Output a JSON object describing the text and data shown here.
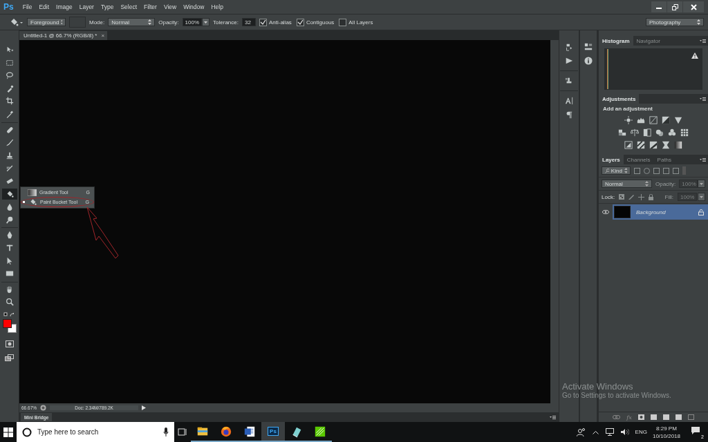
{
  "app": {
    "logo": "Ps"
  },
  "menu": [
    "File",
    "Edit",
    "Image",
    "Layer",
    "Type",
    "Select",
    "Filter",
    "View",
    "Window",
    "Help"
  ],
  "options_bar": {
    "fill_source": "Foreground",
    "mode_label": "Mode:",
    "mode": "Normal",
    "opacity_label": "Opacity:",
    "opacity": "100%",
    "tolerance_label": "Tolerance:",
    "tolerance": "32",
    "checkboxes": [
      {
        "label": "Anti-alias",
        "checked": true
      },
      {
        "label": "Contiguous",
        "checked": true
      },
      {
        "label": "All Layers",
        "checked": false
      }
    ],
    "workspace": "Photography"
  },
  "document_tab": {
    "title": "Untitled-1 @ 66.7% (RGB/8) *",
    "close": "×"
  },
  "tools": [
    {
      "selected": false
    },
    {
      "selected": false
    },
    {
      "selected": false
    },
    {
      "selected": false
    },
    {
      "selected": false
    },
    {
      "selected": false
    },
    {
      "selected": false
    },
    {
      "selected": false
    },
    {
      "selected": false
    },
    {
      "selected": false
    },
    {
      "selected": false
    },
    {
      "selected": true
    },
    {
      "selected": false
    },
    {
      "selected": false
    },
    {
      "selected": false
    },
    {
      "selected": false
    },
    {
      "selected": false
    },
    {
      "selected": false
    },
    {
      "selected": false
    },
    {
      "selected": false
    }
  ],
  "flyout": [
    {
      "label": "Gradient Tool",
      "shortcut": "G",
      "selected": false
    },
    {
      "label": "Paint Bucket Tool",
      "shortcut": "G",
      "selected": true
    }
  ],
  "status_bar": {
    "zoom": "66.67%",
    "doc": "Doc: 2.34M/789.2K"
  },
  "mini_bridge": {
    "label": "Mini Bridge"
  },
  "panels": {
    "histogram_tabs": [
      {
        "label": "Histogram",
        "selected": true
      },
      {
        "label": "Navigator",
        "selected": false
      }
    ],
    "adjustments_tab": "Adjustments",
    "adjustments_heading": "Add an adjustment",
    "layers_tabs": [
      {
        "label": "Layers",
        "selected": true
      },
      {
        "label": "Channels",
        "selected": false
      },
      {
        "label": "Paths",
        "selected": false
      }
    ],
    "filter": "Kind",
    "blend_mode": "Normal",
    "opacity": {
      "label": "Opacity:",
      "value": "100%",
      "disabled": true
    },
    "lock_label": "Lock:",
    "fill": {
      "label": "Fill:",
      "value": "100%",
      "disabled": true
    },
    "layers": [
      {
        "name": "Background",
        "selected": true,
        "visible": true,
        "locked": true
      }
    ],
    "footer_fx": "fx"
  },
  "taskbar": {
    "search_placeholder": "Type here to search",
    "apps": [
      {
        "selected": false
      },
      {
        "selected": false
      },
      {
        "selected": false
      },
      {
        "selected": true
      },
      {
        "selected": false
      },
      {
        "selected": false
      }
    ],
    "ps_label": "Ps",
    "language": "ENG",
    "time": "8:29 PM",
    "date": "10/10/2018",
    "notifications": "2"
  },
  "activation_notice": {
    "title": "Activate Windows",
    "text": "Go to Settings to activate Windows."
  }
}
